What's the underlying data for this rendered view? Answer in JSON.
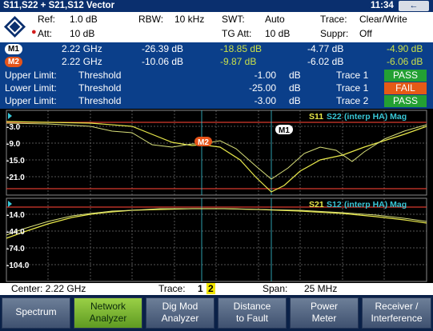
{
  "titlebar": {
    "title": "S11,S22 + S21,S12 Vector",
    "clock": "11:34",
    "back_label": "←"
  },
  "header": {
    "ref_label": "Ref:",
    "ref_value": "1.0 dB",
    "att_label": "Att:",
    "att_value": "10 dB",
    "rbw_label": "RBW:",
    "rbw_value": "10 kHz",
    "swt_label": "SWT:",
    "swt_value": "Auto",
    "tgatt_label": "TG Att:",
    "tgatt_value": "10 dB",
    "trace_label": "Trace:",
    "trace_value": "Clear/Write",
    "suppr_label": "Suppr:",
    "suppr_value": "Off"
  },
  "markers": [
    {
      "badge": "M1",
      "freq": "2.22 GHz",
      "v1": "-26.39 dB",
      "v2": "-18.85 dB",
      "v3": "-4.77 dB",
      "v4": "-4.90 dB"
    },
    {
      "badge": "M2",
      "freq": "2.22 GHz",
      "v1": "-10.06 dB",
      "v2": "-9.87 dB",
      "v3": "-6.02 dB",
      "v4": "-6.06 dB"
    }
  ],
  "limits": [
    {
      "name": "Upper Limit:",
      "type": "Threshold",
      "value": "-1.00",
      "unit": "dB",
      "trace": "Trace 1",
      "result": "PASS"
    },
    {
      "name": "Lower Limit:",
      "type": "Threshold",
      "value": "-25.00",
      "unit": "dB",
      "trace": "Trace 1",
      "result": "FAIL"
    },
    {
      "name": "Upper Limit:",
      "type": "Threshold",
      "value": "-3.00",
      "unit": "dB",
      "trace": "Trace 2",
      "result": "PASS"
    }
  ],
  "plot1": {
    "legend_a": "S11",
    "legend_b": "S22",
    "legend_c": "(interp HA) Mag",
    "ticks": [
      "-3.0",
      "-9.0",
      "-15.0",
      "-21.0"
    ],
    "m1": "M1",
    "m2": "M2"
  },
  "plot2": {
    "legend_a": "S21",
    "legend_b": "S12",
    "legend_c": "(interp HA) Mag",
    "ticks": [
      "-14.0",
      "-44.0",
      "-74.0",
      "-104.0"
    ]
  },
  "infobar": {
    "center": "Center: 2.22 GHz",
    "trace_label": "Trace:",
    "trace1": "1",
    "trace2": "2",
    "span_label": "Span:",
    "span_value": "25 MHz"
  },
  "softkeys": [
    {
      "line1": "Spectrum",
      "line2": ""
    },
    {
      "line1": "Network",
      "line2": "Analyzer"
    },
    {
      "line1": "Dig Mod",
      "line2": "Analyzer"
    },
    {
      "line1": "Distance",
      "line2": "to Fault"
    },
    {
      "line1": "Power",
      "line2": "Meter"
    },
    {
      "line1": "Receiver /",
      "line2": "Interference"
    }
  ],
  "colors": {
    "trace_yellow": "#e8e84a",
    "trace_cyan": "#38c6d6",
    "limit_red": "#d83a2e",
    "pass_green": "#23a033",
    "fail_orange": "#e55a16"
  }
}
